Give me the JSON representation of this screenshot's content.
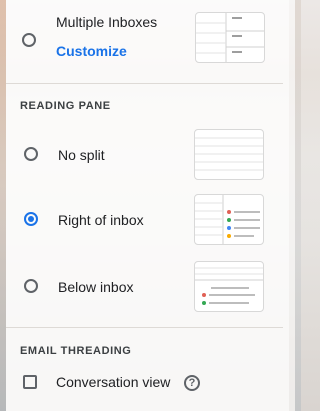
{
  "inbox_type": {
    "multiple_inboxes": {
      "label": "Multiple Inboxes",
      "link": "Customize",
      "selected": false,
      "thumbnail_icon": "multiple-inboxes-layout"
    }
  },
  "reading_pane": {
    "header": "READING PANE",
    "options": [
      {
        "label": "No split",
        "selected": false,
        "thumbnail_icon": "no-split-layout"
      },
      {
        "label": "Right of inbox",
        "selected": true,
        "thumbnail_icon": "right-of-inbox-layout"
      },
      {
        "label": "Below inbox",
        "selected": false,
        "thumbnail_icon": "below-inbox-layout"
      }
    ]
  },
  "email_threading": {
    "header": "EMAIL THREADING",
    "conversation_view": {
      "label": "Conversation view",
      "checked": false,
      "help_icon": "help-circle-icon",
      "help_glyph": "?"
    }
  },
  "colors": {
    "accent": "#1a73e8",
    "text": "#202124",
    "muted": "#5f6368",
    "dot_red": "#e06055",
    "dot_green": "#34a853",
    "dot_blue": "#4285f4",
    "dot_yellow": "#f9ab00"
  }
}
